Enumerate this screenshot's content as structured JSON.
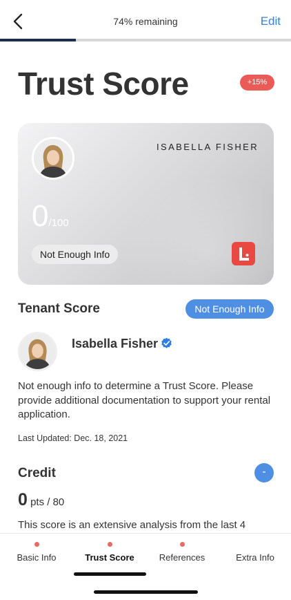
{
  "header": {
    "remaining_label": "74% remaining",
    "edit_label": "Edit",
    "progress_percent": 26
  },
  "page": {
    "title": "Trust Score",
    "delta_badge": "+15%"
  },
  "card": {
    "name": "ISABELLA FISHER",
    "score": "0",
    "score_max": "/100",
    "status": "Not Enough Info",
    "brand_color": "#e84a43"
  },
  "tenant": {
    "section_title": "Tenant Score",
    "status_pill": "Not Enough Info",
    "name": "Isabella Fisher",
    "description": "Not enough info to determine a Trust Score. Please provide additional documentation to support your rental application.",
    "last_updated": "Last Updated: Dec. 18, 2021"
  },
  "credit": {
    "section_title": "Credit",
    "toggle_label": "-",
    "score": "0",
    "score_unit": " pts / 80",
    "description": "This score is an extensive analysis from the last 4"
  },
  "tabs": [
    {
      "label": "Basic Info",
      "active": false
    },
    {
      "label": "Trust Score",
      "active": true
    },
    {
      "label": "References",
      "active": false
    },
    {
      "label": "Extra Info",
      "active": false
    }
  ],
  "colors": {
    "accent": "#3b82d6",
    "badge_red": "#ea5b57",
    "pill_blue": "#4e8fe3"
  }
}
